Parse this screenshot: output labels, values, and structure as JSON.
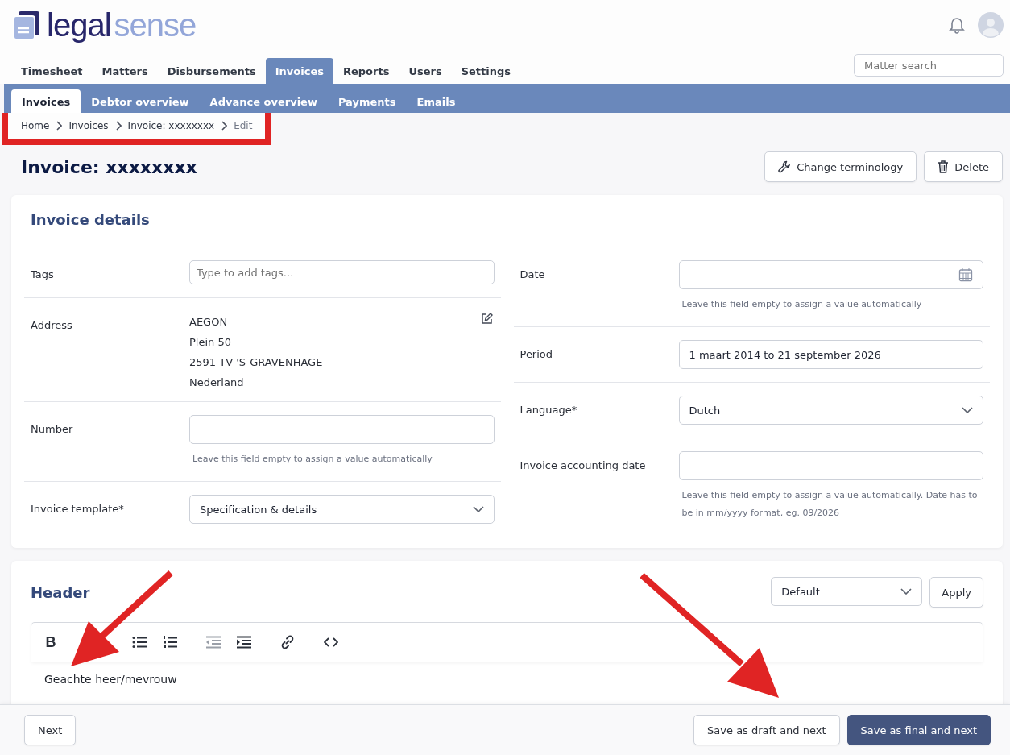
{
  "logo": {
    "first": "legal",
    "second": "sense"
  },
  "main_tabs": [
    {
      "label": "Timesheet",
      "selected": false
    },
    {
      "label": "Matters",
      "selected": false
    },
    {
      "label": "Disbursements",
      "selected": false
    },
    {
      "label": "Invoices",
      "selected": true
    },
    {
      "label": "Reports",
      "selected": false
    },
    {
      "label": "Users",
      "selected": false
    },
    {
      "label": "Settings",
      "selected": false
    }
  ],
  "search": {
    "placeholder": "Matter search"
  },
  "sub_tabs": [
    {
      "label": "Invoices",
      "selected": true
    },
    {
      "label": "Debtor overview",
      "selected": false
    },
    {
      "label": "Advance overview",
      "selected": false
    },
    {
      "label": "Payments",
      "selected": false
    },
    {
      "label": "Emails",
      "selected": false
    }
  ],
  "breadcrumb": {
    "highlighted": true,
    "items": [
      {
        "label": "Home",
        "current": false
      },
      {
        "label": "Invoices",
        "current": false
      },
      {
        "label": "Invoice: xxxxxxxx",
        "current": false
      },
      {
        "label": "Edit",
        "current": true
      }
    ]
  },
  "page_title": "Invoice: xxxxxxxx",
  "actions": [
    {
      "label": "Change terminology",
      "kind": "wrench"
    },
    {
      "label": "Delete",
      "kind": "trash"
    }
  ],
  "details": {
    "title": "Invoice details",
    "left": [
      {
        "label": "Tags",
        "kind": "tags",
        "placeholder": "Type to add tags..."
      },
      {
        "label": "Address",
        "kind": "address",
        "lines": [
          "AEGON",
          "Plein 50",
          "2591 TV 'S-GRAVENHAGE",
          "Nederland"
        ]
      },
      {
        "label": "Number",
        "kind": "input",
        "hint": "Leave this field empty to assign a value automatically"
      },
      {
        "label": "Invoice template*",
        "kind": "select",
        "value": "Specification & details"
      }
    ],
    "right": [
      {
        "label": "Date",
        "kind": "date",
        "hint": "Leave this field empty to assign a value automatically"
      },
      {
        "label": "Period",
        "kind": "input",
        "value": "1 maart 2014 to 21 september 2026"
      },
      {
        "label": "Language*",
        "kind": "select",
        "value": "Dutch"
      },
      {
        "label": "Invoice accounting date",
        "kind": "input",
        "hint": "Leave this field empty to assign a value automatically. Date has to be in mm/yyyy format, eg. 09/2026"
      }
    ]
  },
  "header_section": {
    "title": "Header",
    "template": "Default",
    "apply": "Apply",
    "toolbar": [
      {
        "kind": "bold",
        "label": "B",
        "disabled": false
      },
      {
        "kind": "bullet-list",
        "disabled": false
      },
      {
        "kind": "numbered-list",
        "disabled": false
      },
      {
        "kind": "outdent",
        "disabled": true
      },
      {
        "kind": "indent",
        "disabled": false
      },
      {
        "kind": "link",
        "disabled": false
      },
      {
        "kind": "code",
        "disabled": false
      }
    ],
    "text": "Geachte heer/mevrouw"
  },
  "footer": [
    {
      "label": "Next",
      "kind": "secondary",
      "pointer": {
        "kind": "down-left"
      }
    },
    {
      "label": "Save as draft and next",
      "kind": "secondary",
      "pointer": {
        "kind": "down-right"
      }
    },
    {
      "label": "Save as final and next",
      "kind": "primary"
    }
  ]
}
